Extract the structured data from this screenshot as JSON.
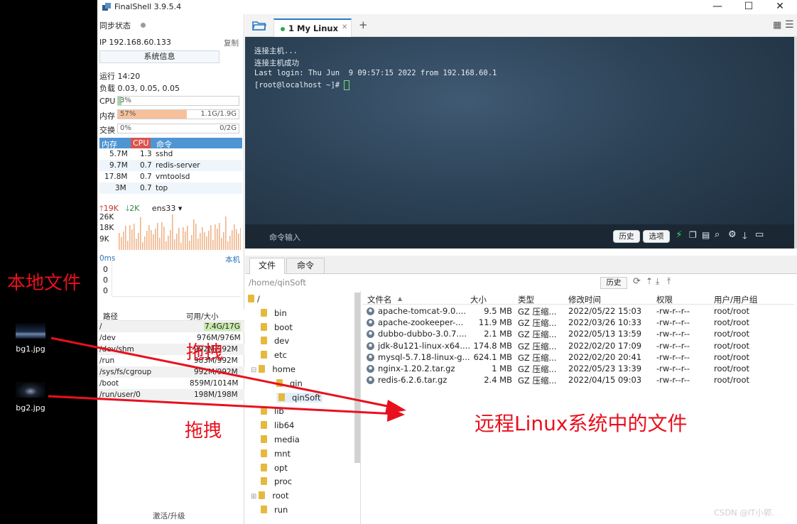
{
  "desktop": {
    "annotation_local": "本地文件",
    "icons": [
      {
        "label": "bg1.jpg"
      },
      {
        "label": "bg2.jpg"
      }
    ]
  },
  "window": {
    "title": "FinalShell 3.9.5.4",
    "minimize": "—",
    "maximize": "☐",
    "close": "✕"
  },
  "sidebar": {
    "sync_label": "同步状态",
    "ip": "IP 192.168.60.133",
    "copy_label": "复制",
    "sysinfo_button": "系统信息",
    "uptime": "运行 14:20",
    "load": "负载 0.03, 0.05, 0.05",
    "cpu_label": "CPU",
    "cpu_pct": "3%",
    "cpu_level": 0.03,
    "mem_label": "内存",
    "mem_pct": "57%",
    "mem_level": 0.57,
    "mem_used": "1.1G/1.9G",
    "swap_label": "交换",
    "swap_pct": "0%",
    "swap_level": 0,
    "swap_used": "0/2G",
    "proc_headers": [
      "内存",
      "CPU",
      "命令"
    ],
    "processes": [
      {
        "mem": "5.7M",
        "cpu": "1.3",
        "cmd": "sshd"
      },
      {
        "mem": "9.7M",
        "cpu": "0.7",
        "cmd": "redis-server"
      },
      {
        "mem": "17.8M",
        "cpu": "0.7",
        "cmd": "vmtoolsd"
      },
      {
        "mem": "3M",
        "cpu": "0.7",
        "cmd": "top"
      }
    ],
    "net_up": "19K",
    "net_down": "2K",
    "net_iface": "ens33",
    "net_ticks": [
      "26K",
      "18K",
      "9K"
    ],
    "ping_label": "0ms",
    "ping_host": "本机",
    "ping_values": [
      "0",
      "0",
      "0"
    ],
    "disk_headers": [
      "路径",
      "可用/大小"
    ],
    "disks": [
      {
        "path": "/",
        "size": "7.4G/17G"
      },
      {
        "path": "/dev",
        "size": "976M/976M"
      },
      {
        "path": "/dev/shm",
        "size": "992M/992M"
      },
      {
        "path": "/run",
        "size": "983M/992M"
      },
      {
        "path": "/sys/fs/cgroup",
        "size": "992M/992M"
      },
      {
        "path": "/boot",
        "size": "859M/1014M"
      },
      {
        "path": "/run/user/0",
        "size": "198M/198M"
      }
    ],
    "activate_label": "激活/升级"
  },
  "tabs": {
    "active": "1 My Linux"
  },
  "terminal": {
    "lines": [
      "连接主机...",
      "连接主机成功",
      "Last login: Thu Jun  9 09:57:15 2022 from 192.168.60.1",
      "[root@localhost ~]# "
    ],
    "cmd_placeholder": "命令输入",
    "history_btn": "历史",
    "options_btn": "选项"
  },
  "filepanel": {
    "tab_files": "文件",
    "tab_cmds": "命令",
    "path": "/home/qinSoft",
    "history_btn": "历史",
    "tree": [
      "/",
      "bin",
      "boot",
      "dev",
      "etc",
      "home",
      "qin",
      "qinSoft",
      "lib",
      "lib64",
      "media",
      "mnt",
      "opt",
      "proc",
      "root",
      "run"
    ],
    "columns": [
      "文件名",
      "大小",
      "类型",
      "修改时间",
      "权限",
      "用户/用户组"
    ],
    "files": [
      {
        "name": "apache-tomcat-9.0....",
        "size": "9.5 MB",
        "type": "GZ 压缩...",
        "mtime": "2022/05/22 15:03",
        "perm": "-rw-r--r--",
        "owner": "root/root"
      },
      {
        "name": "apache-zookeeper-...",
        "size": "11.9 MB",
        "type": "GZ 压缩...",
        "mtime": "2022/03/26 10:33",
        "perm": "-rw-r--r--",
        "owner": "root/root"
      },
      {
        "name": "dubbo-dubbo-3.0.7....",
        "size": "2.1 MB",
        "type": "GZ 压缩...",
        "mtime": "2022/05/13 13:59",
        "perm": "-rw-r--r--",
        "owner": "root/root"
      },
      {
        "name": "jdk-8u121-linux-x64....",
        "size": "174.8 MB",
        "type": "GZ 压缩...",
        "mtime": "2022/02/20 17:09",
        "perm": "-rw-r--r--",
        "owner": "root/root"
      },
      {
        "name": "mysql-5.7.18-linux-g...",
        "size": "624.1 MB",
        "type": "GZ 压缩...",
        "mtime": "2022/02/20 20:41",
        "perm": "-rw-r--r--",
        "owner": "root/root"
      },
      {
        "name": "nginx-1.20.2.tar.gz",
        "size": "1 MB",
        "type": "GZ 压缩...",
        "mtime": "2022/05/23 13:39",
        "perm": "-rw-r--r--",
        "owner": "root/root"
      },
      {
        "name": "redis-6.2.6.tar.gz",
        "size": "2.4 MB",
        "type": "GZ 压缩...",
        "mtime": "2022/04/15 09:03",
        "perm": "-rw-r--r--",
        "owner": "root/root"
      }
    ]
  },
  "annotations": {
    "drag1": "拖拽",
    "drag2": "拖拽",
    "remote": "远程Linux系统中的文件"
  },
  "watermark": "CSDN @IT小郭.",
  "colors": {
    "accent": "#4f95d3",
    "memfill": "#f6c19a",
    "cpufill": "#9fd3a6",
    "annotation": "#e8101d",
    "cpuheader": "#d9534f"
  }
}
